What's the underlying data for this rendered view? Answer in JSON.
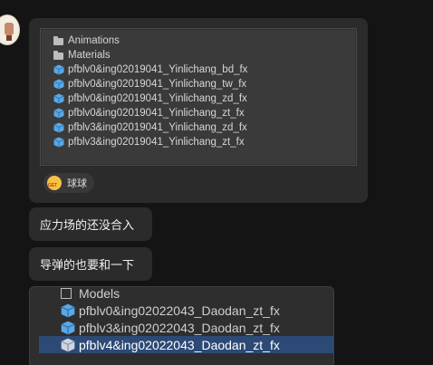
{
  "chat": {
    "message1": {
      "files": [
        {
          "icon": "folder-icon",
          "name": "Animations"
        },
        {
          "icon": "folder-icon",
          "name": "Materials"
        },
        {
          "icon": "prefab-icon",
          "name": "pfblv0&ing02019041_Yinlichang_bd_fx"
        },
        {
          "icon": "prefab-icon",
          "name": "pfblv0&ing02019041_Yinlichang_tw_fx"
        },
        {
          "icon": "prefab-icon",
          "name": "pfblv0&ing02019041_Yinlichang_zd_fx"
        },
        {
          "icon": "prefab-icon",
          "name": "pfblv0&ing02019041_Yinlichang_zt_fx"
        },
        {
          "icon": "prefab-icon",
          "name": "pfblv3&ing02019041_Yinlichang_zd_fx"
        },
        {
          "icon": "prefab-icon",
          "name": "pfblv3&ing02019041_Yinlichang_zt_fx"
        }
      ],
      "reaction": {
        "emoji_text": "GET",
        "label": "球球"
      }
    },
    "message2": {
      "text": "应力场的还没合入"
    },
    "message3": {
      "text": "导弹的也要和一下"
    },
    "message4": {
      "files": [
        {
          "icon": "folder-outline-icon",
          "name": "Models",
          "selected": false
        },
        {
          "icon": "prefab-icon",
          "name": "pfblv0&ing02022043_Daodan_zt_fx",
          "selected": false
        },
        {
          "icon": "prefab-icon",
          "name": "pfblv3&ing02022043_Daodan_zt_fx",
          "selected": false
        },
        {
          "icon": "prefab-icon",
          "name": "pfblv4&ing02022043_Daodan_zt_fx",
          "selected": true
        }
      ]
    }
  },
  "colors": {
    "background": "#141414",
    "bubble": "#2b2b2b",
    "prefab_blue": "#5aa8e6",
    "selection": "#2c4a75"
  }
}
